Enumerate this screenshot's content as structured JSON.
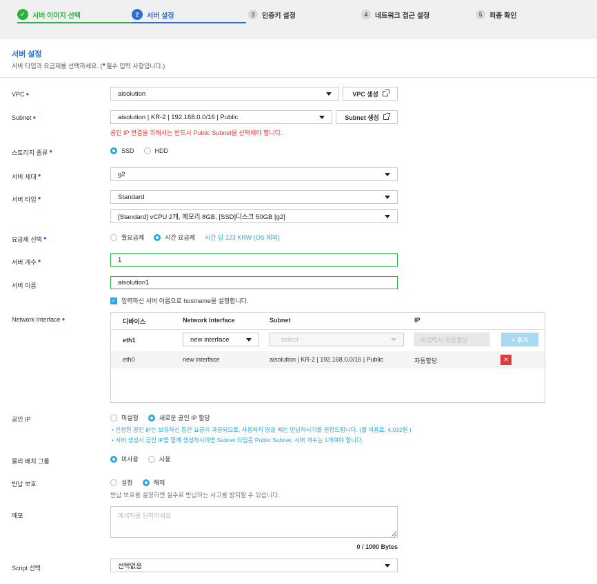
{
  "steps": [
    {
      "num": "✓",
      "label": "서버 이미지 선택"
    },
    {
      "num": "2",
      "label": "서버 설정"
    },
    {
      "num": "3",
      "label": "인증키 설정"
    },
    {
      "num": "4",
      "label": "네트워크 접근 설정"
    },
    {
      "num": "5",
      "label": "최종 확인"
    }
  ],
  "header": {
    "title": "서버 설정",
    "subtitle_a": "서버 타입과 요금제를 선택하세요. (",
    "subtitle_b": "필수 입력 사항입니다.)"
  },
  "vpc": {
    "label": "VPC",
    "value": "aisolution",
    "button": "VPC 생성"
  },
  "subnet": {
    "label": "Subnet",
    "value": "aisolution | KR-2 | 192.168.0.0/16 | Public",
    "button": "Subnet 생성",
    "hint": "공인 IP 연결을 위해서는 반드시 Public Subnet을 선택해야 합니다."
  },
  "storage": {
    "label": "스토리지 종류",
    "options": [
      "SSD",
      "HDD"
    ],
    "selected": "SSD"
  },
  "generation": {
    "label": "서버 세대",
    "value": "g2"
  },
  "server_type": {
    "label": "서버 타입",
    "value": "Standard",
    "spec": "[Standard] vCPU 2개, 메모리 8GB, [SSD]디스크 50GB [g2]"
  },
  "billing": {
    "label": "요금제 선택",
    "options": [
      "월요금제",
      "시간 요금제"
    ],
    "selected": "시간 요금제",
    "price": "시간 당 123 KRW (OS 제외)"
  },
  "count": {
    "label": "서버 개수",
    "value": "1"
  },
  "name": {
    "label": "서버 이름",
    "value": "aisolution1",
    "checkbox": "입력하신 서버 이름으로 hostname을 설정합니다."
  },
  "network": {
    "label": "Network Interface",
    "headers": [
      "디바이스",
      "Network Interface",
      "Subnet",
      "IP"
    ],
    "new_row": {
      "device": "eth1",
      "interface": "new interface",
      "subnet_placeholder": "- select -",
      "ip_placeholder": "미입력시 자동할당",
      "add": "+ 추가"
    },
    "rows": [
      {
        "device": "eth0",
        "interface": "new interface",
        "subnet": "aisolution | KR-2 | 192.168.0.0/16 | Public",
        "ip": "자동할당",
        "delete": "✕"
      }
    ]
  },
  "public_ip": {
    "label": "공인 IP",
    "options": [
      "미설정",
      "새로운 공인 IP 할당"
    ],
    "selected": "새로운 공인 IP 할당",
    "notes": [
      "신청된 공인 IP는 보유하신 동안 요금이 과금되므로, 사용하지 않을 때는 반납하시기를 권장드립니다. (월 이용료: 4,032원 )",
      "서버 생성시 공인 IP를 함께 생성하시려면 Subnet 타입은 Public Subnet, 서버 개수는 1개여야 합니다."
    ]
  },
  "placement": {
    "label": "물리 배치 그룹",
    "options": [
      "미사용",
      "사용"
    ],
    "selected": "미사용"
  },
  "protection": {
    "label": "반납 보호",
    "options": [
      "설정",
      "해제"
    ],
    "selected": "해제",
    "hint": "반납 보호를 설정하면 실수로 반납하는 사고를 방지할 수 있습니다."
  },
  "memo": {
    "label": "메모",
    "placeholder": "메세지를 입력하세요",
    "counter": "0 / 1000 Bytes"
  },
  "script": {
    "label": "Script 선택",
    "value": "선택없음"
  },
  "colors": {
    "accent": "#2b6fd6",
    "done": "#27b33c",
    "info": "#2ba7e0",
    "error": "#e03a3a"
  }
}
